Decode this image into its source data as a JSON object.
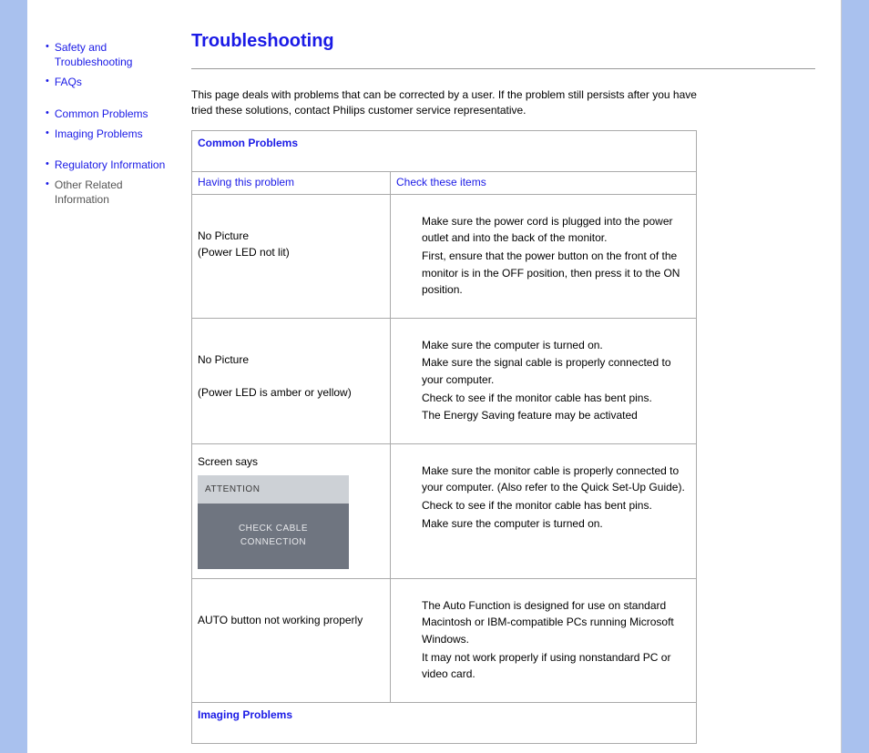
{
  "sidebar": {
    "items": [
      {
        "label": "Safety and Troubleshooting",
        "muted": false
      },
      {
        "label": "FAQs",
        "muted": false
      },
      {
        "label": "Common Problems",
        "muted": false
      },
      {
        "label": "Imaging Problems",
        "muted": false
      },
      {
        "label": "Regulatory Information",
        "muted": false
      },
      {
        "label": "Other Related Information",
        "muted": true
      }
    ]
  },
  "title": "Troubleshooting",
  "intro": "This page deals with problems that can be corrected by a user. If the problem still persists after you have tried these solutions, contact Philips customer service representative.",
  "table": {
    "section1": "Common Problems",
    "head_problem": "Having this problem",
    "head_solution": "Check these items",
    "rows": [
      {
        "problem_line1": "No Picture",
        "problem_line2": "(Power LED not lit)",
        "solutions": [
          "Make sure the power cord is plugged into the power outlet and into the back of the monitor.",
          "First, ensure that the power button on the front of the monitor is in the OFF position, then press it to the ON position."
        ]
      },
      {
        "problem_line1": "No Picture",
        "problem_line2": "(Power LED is amber or yellow)",
        "solutions": [
          "Make sure the computer is turned on.",
          "Make sure the signal cable is properly connected to your computer.",
          "Check to see if the monitor cable has bent pins.",
          "The Energy Saving feature may be activated"
        ]
      },
      {
        "problem_text": "Screen says",
        "osd_head": "ATTENTION",
        "osd_body": "CHECK CABLE CONNECTION",
        "solutions": [
          "Make sure the monitor cable is properly connected to your computer. (Also refer to the Quick Set-Up Guide).",
          "Check to see if the monitor cable has bent pins.",
          "Make sure the computer is turned on."
        ]
      },
      {
        "problem_text": "AUTO button not working properly",
        "solutions": [
          "The Auto Function is designed for use on standard Macintosh or IBM-compatible PCs running Microsoft Windows.",
          "It may not work properly if using nonstandard PC or video card."
        ]
      }
    ],
    "section2": "Imaging Problems"
  }
}
